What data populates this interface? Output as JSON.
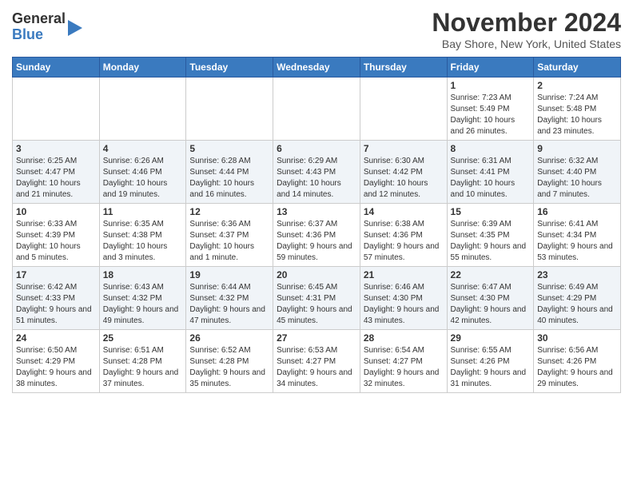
{
  "logo": {
    "line1": "General",
    "line2": "Blue"
  },
  "title": "November 2024",
  "location": "Bay Shore, New York, United States",
  "weekdays": [
    "Sunday",
    "Monday",
    "Tuesday",
    "Wednesday",
    "Thursday",
    "Friday",
    "Saturday"
  ],
  "weeks": [
    [
      {
        "day": null,
        "info": null
      },
      {
        "day": null,
        "info": null
      },
      {
        "day": null,
        "info": null
      },
      {
        "day": null,
        "info": null
      },
      {
        "day": null,
        "info": null
      },
      {
        "day": "1",
        "info": "Sunrise: 7:23 AM\nSunset: 5:49 PM\nDaylight: 10 hours and 26 minutes."
      },
      {
        "day": "2",
        "info": "Sunrise: 7:24 AM\nSunset: 5:48 PM\nDaylight: 10 hours and 23 minutes."
      }
    ],
    [
      {
        "day": "3",
        "info": "Sunrise: 6:25 AM\nSunset: 4:47 PM\nDaylight: 10 hours and 21 minutes."
      },
      {
        "day": "4",
        "info": "Sunrise: 6:26 AM\nSunset: 4:46 PM\nDaylight: 10 hours and 19 minutes."
      },
      {
        "day": "5",
        "info": "Sunrise: 6:28 AM\nSunset: 4:44 PM\nDaylight: 10 hours and 16 minutes."
      },
      {
        "day": "6",
        "info": "Sunrise: 6:29 AM\nSunset: 4:43 PM\nDaylight: 10 hours and 14 minutes."
      },
      {
        "day": "7",
        "info": "Sunrise: 6:30 AM\nSunset: 4:42 PM\nDaylight: 10 hours and 12 minutes."
      },
      {
        "day": "8",
        "info": "Sunrise: 6:31 AM\nSunset: 4:41 PM\nDaylight: 10 hours and 10 minutes."
      },
      {
        "day": "9",
        "info": "Sunrise: 6:32 AM\nSunset: 4:40 PM\nDaylight: 10 hours and 7 minutes."
      }
    ],
    [
      {
        "day": "10",
        "info": "Sunrise: 6:33 AM\nSunset: 4:39 PM\nDaylight: 10 hours and 5 minutes."
      },
      {
        "day": "11",
        "info": "Sunrise: 6:35 AM\nSunset: 4:38 PM\nDaylight: 10 hours and 3 minutes."
      },
      {
        "day": "12",
        "info": "Sunrise: 6:36 AM\nSunset: 4:37 PM\nDaylight: 10 hours and 1 minute."
      },
      {
        "day": "13",
        "info": "Sunrise: 6:37 AM\nSunset: 4:36 PM\nDaylight: 9 hours and 59 minutes."
      },
      {
        "day": "14",
        "info": "Sunrise: 6:38 AM\nSunset: 4:36 PM\nDaylight: 9 hours and 57 minutes."
      },
      {
        "day": "15",
        "info": "Sunrise: 6:39 AM\nSunset: 4:35 PM\nDaylight: 9 hours and 55 minutes."
      },
      {
        "day": "16",
        "info": "Sunrise: 6:41 AM\nSunset: 4:34 PM\nDaylight: 9 hours and 53 minutes."
      }
    ],
    [
      {
        "day": "17",
        "info": "Sunrise: 6:42 AM\nSunset: 4:33 PM\nDaylight: 9 hours and 51 minutes."
      },
      {
        "day": "18",
        "info": "Sunrise: 6:43 AM\nSunset: 4:32 PM\nDaylight: 9 hours and 49 minutes."
      },
      {
        "day": "19",
        "info": "Sunrise: 6:44 AM\nSunset: 4:32 PM\nDaylight: 9 hours and 47 minutes."
      },
      {
        "day": "20",
        "info": "Sunrise: 6:45 AM\nSunset: 4:31 PM\nDaylight: 9 hours and 45 minutes."
      },
      {
        "day": "21",
        "info": "Sunrise: 6:46 AM\nSunset: 4:30 PM\nDaylight: 9 hours and 43 minutes."
      },
      {
        "day": "22",
        "info": "Sunrise: 6:47 AM\nSunset: 4:30 PM\nDaylight: 9 hours and 42 minutes."
      },
      {
        "day": "23",
        "info": "Sunrise: 6:49 AM\nSunset: 4:29 PM\nDaylight: 9 hours and 40 minutes."
      }
    ],
    [
      {
        "day": "24",
        "info": "Sunrise: 6:50 AM\nSunset: 4:29 PM\nDaylight: 9 hours and 38 minutes."
      },
      {
        "day": "25",
        "info": "Sunrise: 6:51 AM\nSunset: 4:28 PM\nDaylight: 9 hours and 37 minutes."
      },
      {
        "day": "26",
        "info": "Sunrise: 6:52 AM\nSunset: 4:28 PM\nDaylight: 9 hours and 35 minutes."
      },
      {
        "day": "27",
        "info": "Sunrise: 6:53 AM\nSunset: 4:27 PM\nDaylight: 9 hours and 34 minutes."
      },
      {
        "day": "28",
        "info": "Sunrise: 6:54 AM\nSunset: 4:27 PM\nDaylight: 9 hours and 32 minutes."
      },
      {
        "day": "29",
        "info": "Sunrise: 6:55 AM\nSunset: 4:26 PM\nDaylight: 9 hours and 31 minutes."
      },
      {
        "day": "30",
        "info": "Sunrise: 6:56 AM\nSunset: 4:26 PM\nDaylight: 9 hours and 29 minutes."
      }
    ]
  ]
}
